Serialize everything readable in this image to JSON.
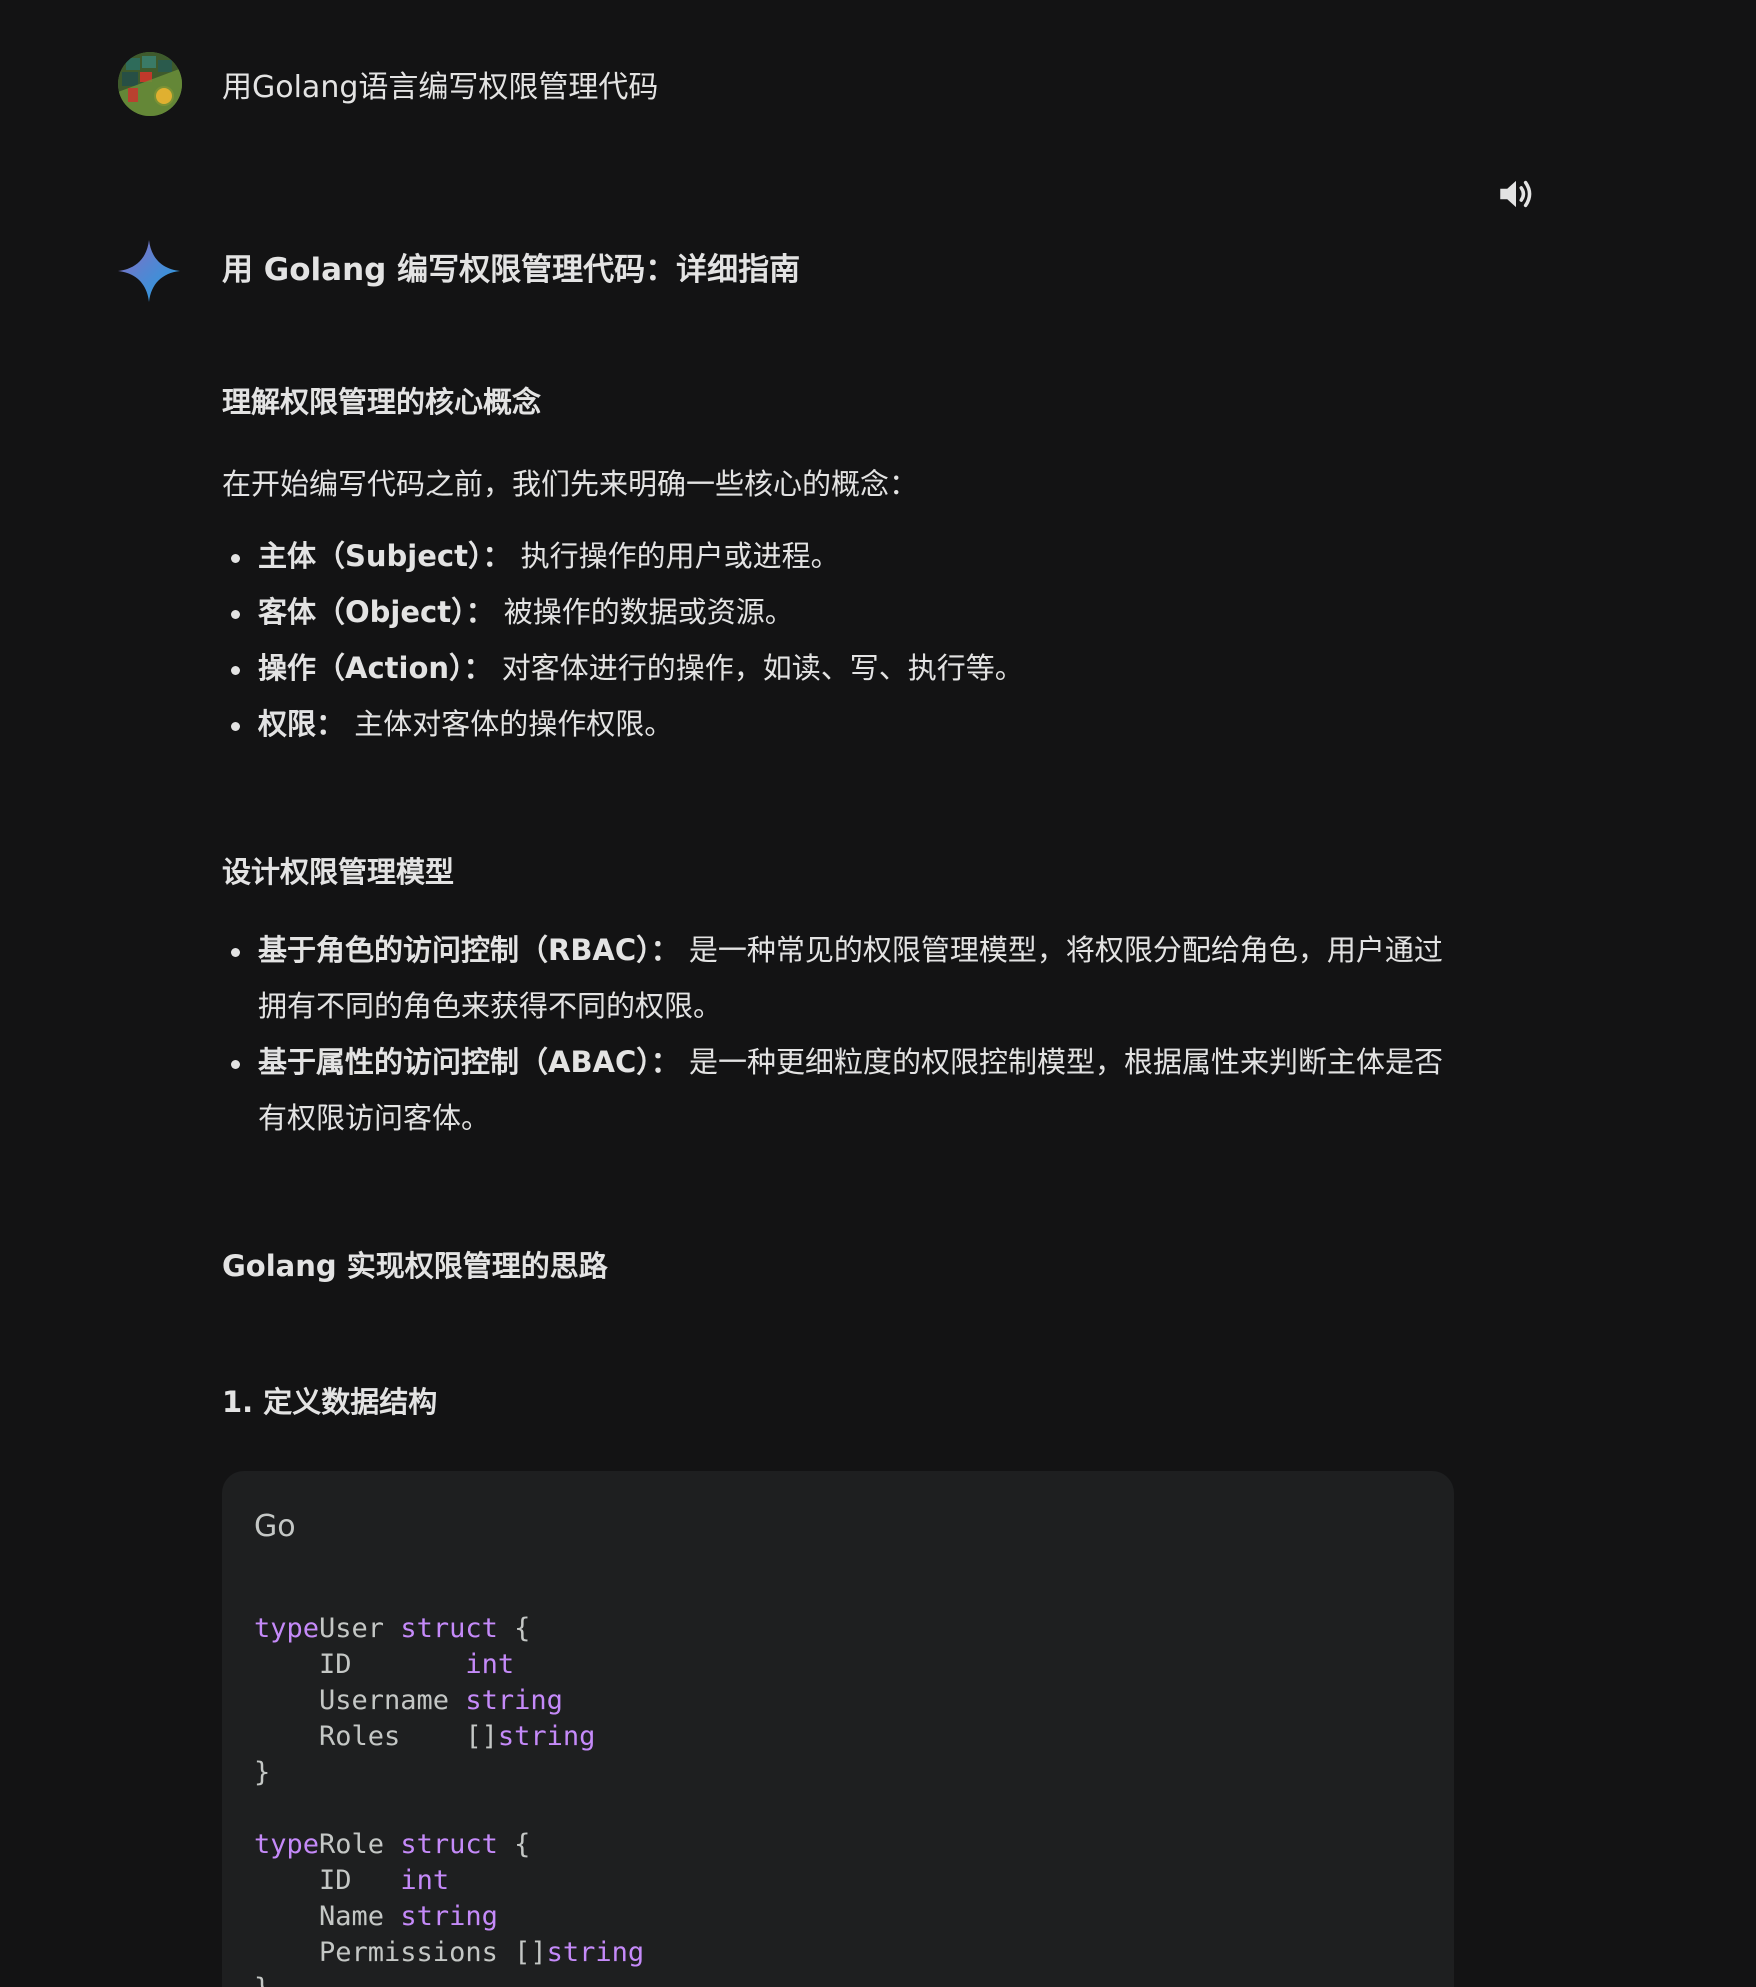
{
  "prompt": {
    "text": "用Golang语言编写权限管理代码"
  },
  "response": {
    "title": "用 Golang 编写权限管理代码：详细指南",
    "section1": {
      "heading": "理解权限管理的核心概念",
      "intro": "在开始编写代码之前，我们先来明确一些核心的概念：",
      "items": [
        {
          "term": "主体（Subject）：",
          "desc": " 执行操作的用户或进程。"
        },
        {
          "term": "客体（Object）：",
          "desc": " 被操作的数据或资源。"
        },
        {
          "term": "操作（Action）：",
          "desc": " 对客体进行的操作，如读、写、执行等。"
        },
        {
          "term": "权限：",
          "desc": " 主体对客体的操作权限。"
        }
      ]
    },
    "section2": {
      "heading": "设计权限管理模型",
      "items": [
        {
          "term": "基于角色的访问控制（RBAC）：",
          "desc": " 是一种常见的权限管理模型，将权限分配给角色，用户通过拥有不同的角色来获得不同的权限。"
        },
        {
          "term": "基于属性的访问控制（ABAC）：",
          "desc": " 是一种更细粒度的权限控制模型，根据属性来判断主体是否有权限访问客体。"
        }
      ]
    },
    "section3": {
      "heading": "Golang 实现权限管理的思路"
    },
    "section4": {
      "heading": "1. 定义数据结构"
    },
    "code": {
      "language": "Go",
      "lines": [
        [
          [
            "kw",
            "type"
          ],
          [
            "",
            "User "
          ],
          [
            "kw",
            "struct"
          ],
          [
            "",
            " {"
          ]
        ],
        [
          [
            "",
            "    ID       "
          ],
          [
            "kw",
            "int"
          ]
        ],
        [
          [
            "",
            "    Username "
          ],
          [
            "kw",
            "string"
          ]
        ],
        [
          [
            "",
            "    Roles    []"
          ],
          [
            "kw",
            "string"
          ]
        ],
        [
          [
            "",
            "}"
          ]
        ],
        [
          [
            "",
            ""
          ]
        ],
        [
          [
            "kw",
            "type"
          ],
          [
            "",
            "Role "
          ],
          [
            "kw",
            "struct"
          ],
          [
            "",
            " {"
          ]
        ],
        [
          [
            "",
            "    ID   "
          ],
          [
            "kw",
            "int"
          ]
        ],
        [
          [
            "",
            "    Name "
          ],
          [
            "kw",
            "string"
          ]
        ],
        [
          [
            "",
            "    Permissions []"
          ],
          [
            "kw",
            "string"
          ]
        ],
        [
          [
            "",
            "}"
          ]
        ]
      ]
    },
    "colors": {
      "background": "#131314",
      "code_background": "#1e1f20",
      "keyword": "#c58af9",
      "text": "#e3e3e3"
    },
    "icons": {
      "speaker": "speaker-icon",
      "gemini": "gemini-spark-icon"
    }
  }
}
